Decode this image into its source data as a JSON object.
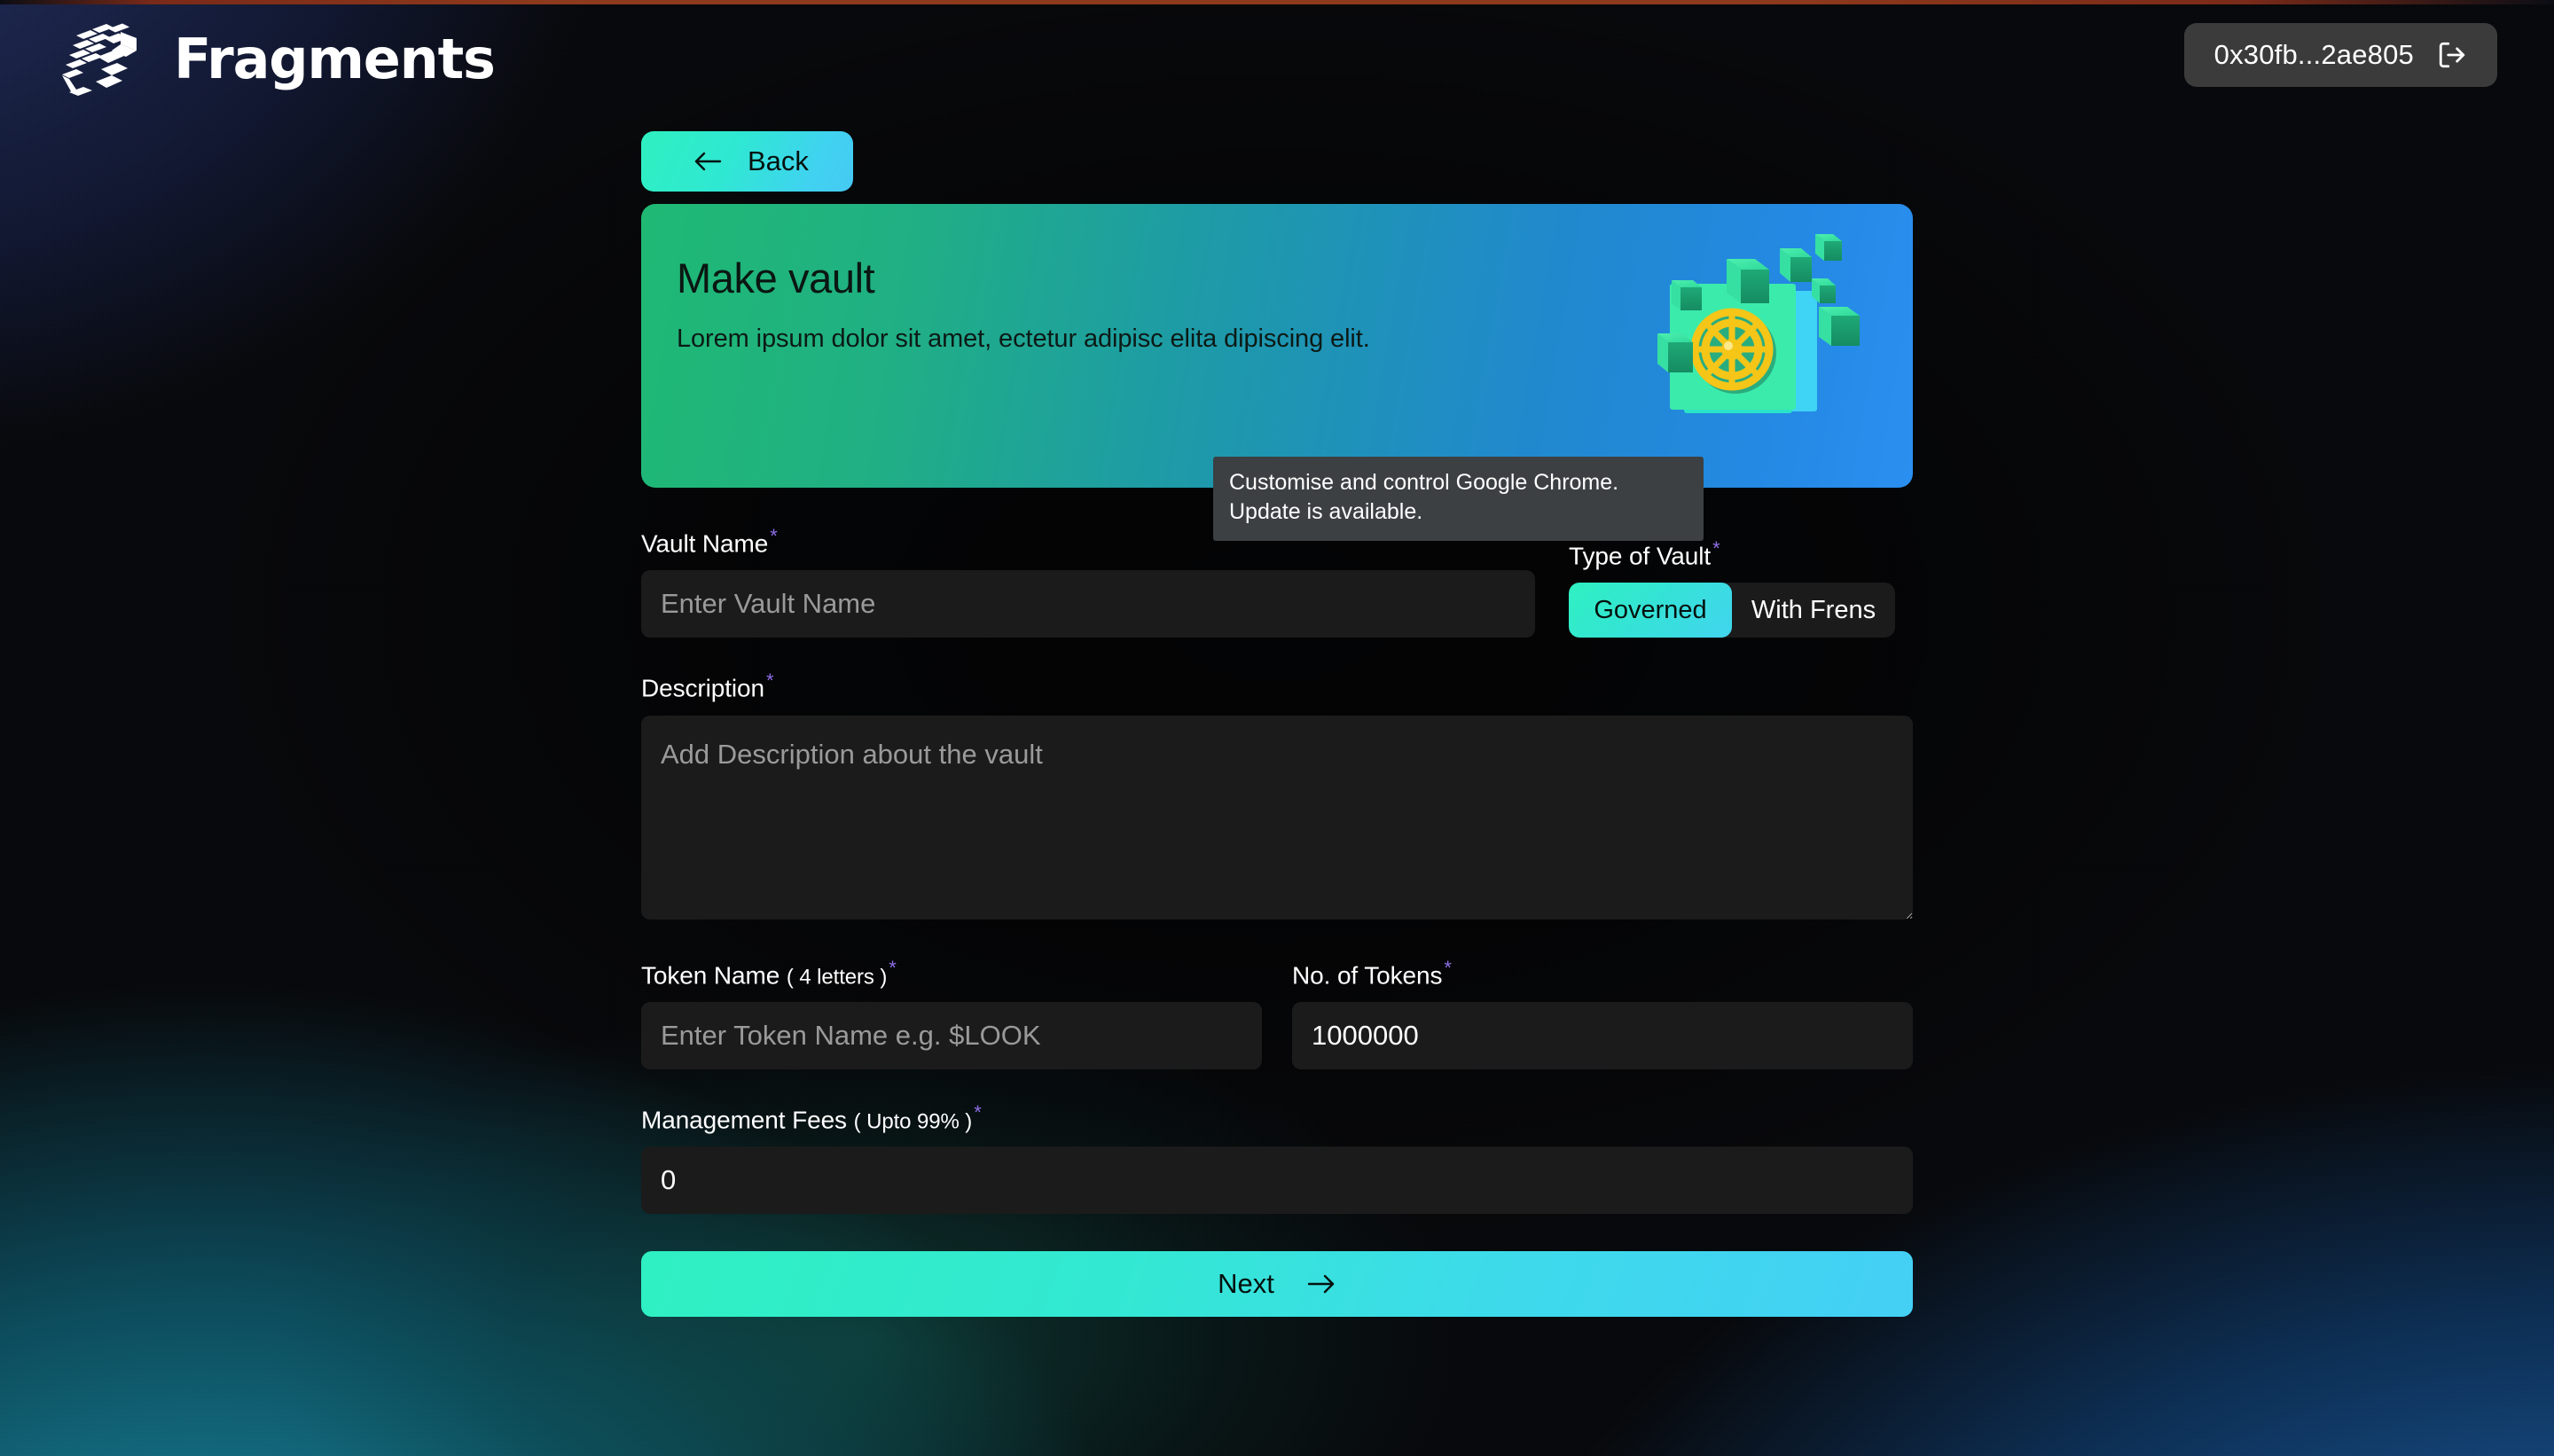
{
  "header": {
    "logo_text": "Fragments",
    "logo_icon": "fragments-logo-icon",
    "wallet_address": "0x30fb...2ae805",
    "logout_icon": "logout-icon"
  },
  "nav": {
    "back_label": "Back",
    "back_icon": "arrow-left-icon"
  },
  "hero": {
    "title": "Make vault",
    "subtitle": "Lorem ipsum dolor sit amet, ectetur adipisc elita dipiscing elit.",
    "art_icon": "vault-door-icon"
  },
  "tooltip": {
    "text": "Customise and control Google Chrome. Update is available."
  },
  "form": {
    "required_mark": "*",
    "vault_name": {
      "label": "Vault Name",
      "placeholder": "Enter Vault Name",
      "value": ""
    },
    "type_of_vault": {
      "label": "Type of Vault",
      "options": [
        "Governed",
        "With Frens"
      ],
      "selected": "Governed"
    },
    "description": {
      "label": "Description",
      "placeholder": "Add Description about the vault",
      "value": ""
    },
    "token_name": {
      "label": "Token Name",
      "hint": "( 4 letters )",
      "placeholder": "Enter Token Name e.g. $LOOK",
      "value": ""
    },
    "no_of_tokens": {
      "label": "No. of Tokens",
      "placeholder": "",
      "value": "1000000"
    },
    "management_fees": {
      "label": "Management Fees",
      "hint": "( Upto 99% )",
      "placeholder": "",
      "value": "0"
    },
    "submit": {
      "label": "Next",
      "icon": "arrow-right-icon"
    }
  },
  "colors": {
    "accent_teal": "#2ff0c2",
    "accent_cyan": "#44cff5",
    "hero_green": "#1fb974",
    "hero_blue": "#2a8ff0",
    "required_purple": "#8e6ee8",
    "input_bg": "#1b1b1b",
    "tooltip_bg": "#3c4043"
  }
}
